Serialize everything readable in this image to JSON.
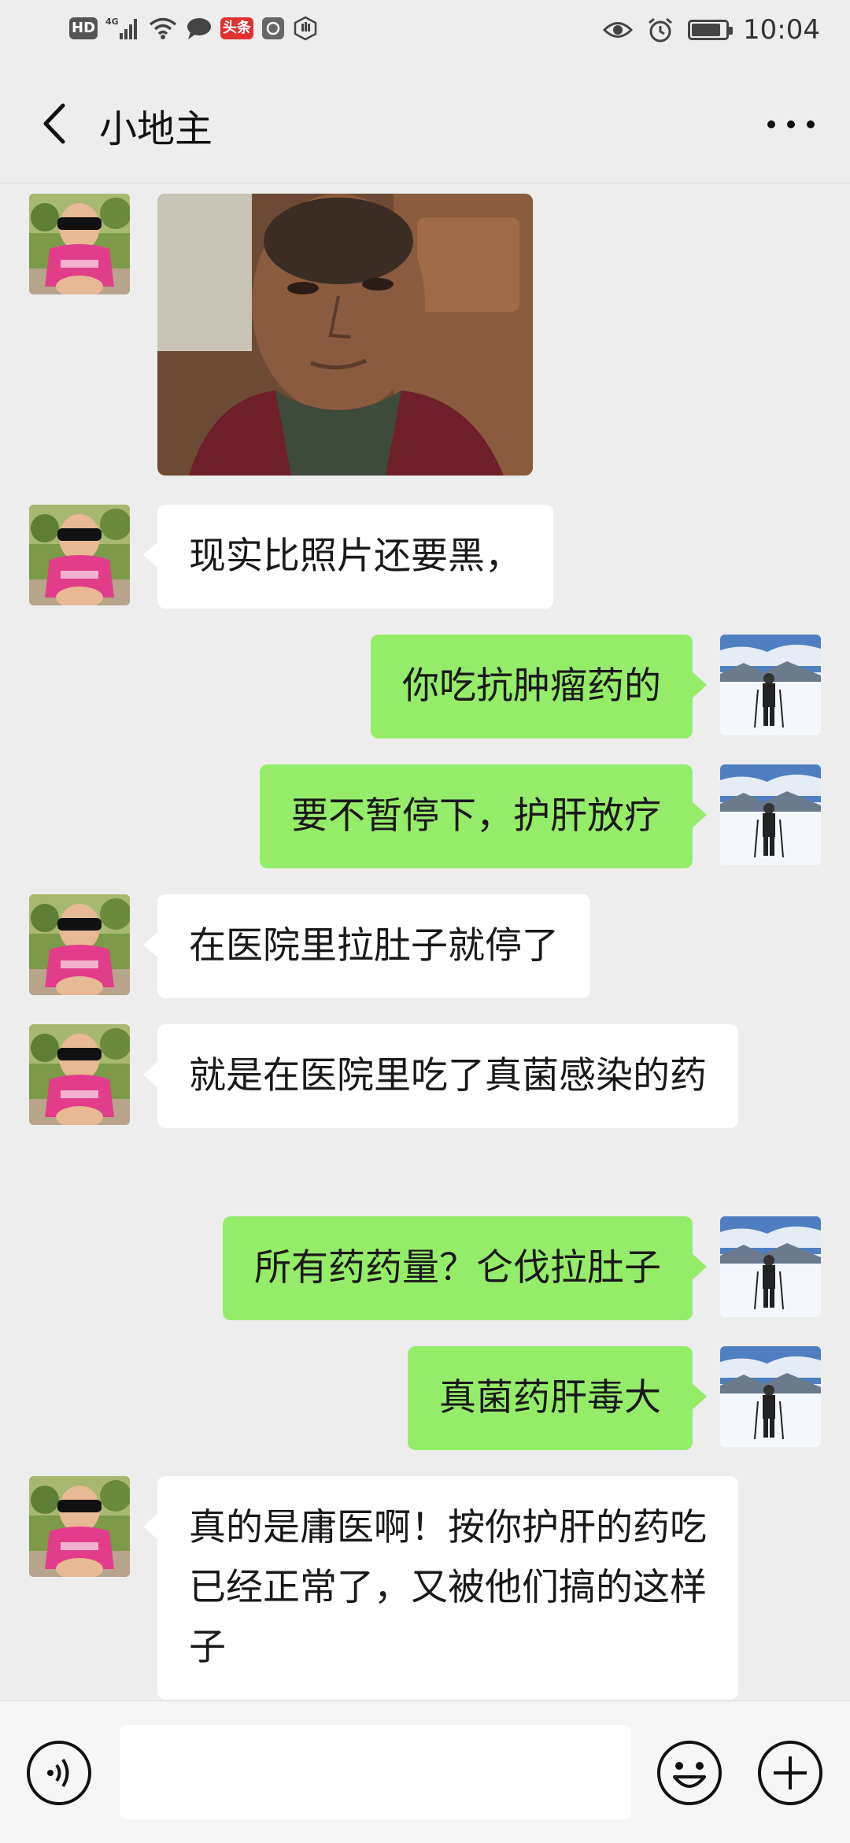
{
  "status_bar": {
    "left_icons": [
      "hd-icon",
      "4g-signal-icon",
      "wifi-icon",
      "message-icon",
      "toutiao-icon",
      "app-icon",
      "hand-icon"
    ],
    "hd_label": "HD",
    "toutiao_label": "头条",
    "time": "10:04",
    "right_icons": [
      "eye-icon",
      "alarm-icon",
      "battery-icon"
    ],
    "battery_level": 0.85
  },
  "header": {
    "title": "小地主",
    "back_icon": "chevron-left-icon",
    "more_icon": "more-dots-icon"
  },
  "messages": [
    {
      "side": "left",
      "type": "image",
      "avatar": "child-sunglasses-avatar"
    },
    {
      "side": "left",
      "type": "text",
      "text": "现实比照片还要黑，"
    },
    {
      "side": "right",
      "type": "text",
      "text": "你吃抗肿瘤药的"
    },
    {
      "side": "right",
      "type": "text",
      "text": "要不暂停下，护肝放疗"
    },
    {
      "side": "left",
      "type": "text",
      "text": "在医院里拉肚子就停了"
    },
    {
      "side": "left",
      "type": "text",
      "text": "就是在医院里吃了真菌感染的药"
    },
    {
      "side": "right",
      "type": "text",
      "text": "所有药药量？仑伐拉肚子"
    },
    {
      "side": "right",
      "type": "text",
      "text": "真菌药肝毒大"
    },
    {
      "side": "left",
      "type": "text",
      "text": "真的是庸医啊！按你护肝的药吃已经正常了，又被他们搞的这样子"
    }
  ],
  "input_bar": {
    "voice_icon": "voice-icon",
    "emoji_icon": "emoji-icon",
    "plus_icon": "plus-icon",
    "text_value": ""
  },
  "colors": {
    "background": "#ededed",
    "self_bubble": "#95ec69",
    "other_bubble": "#ffffff"
  }
}
